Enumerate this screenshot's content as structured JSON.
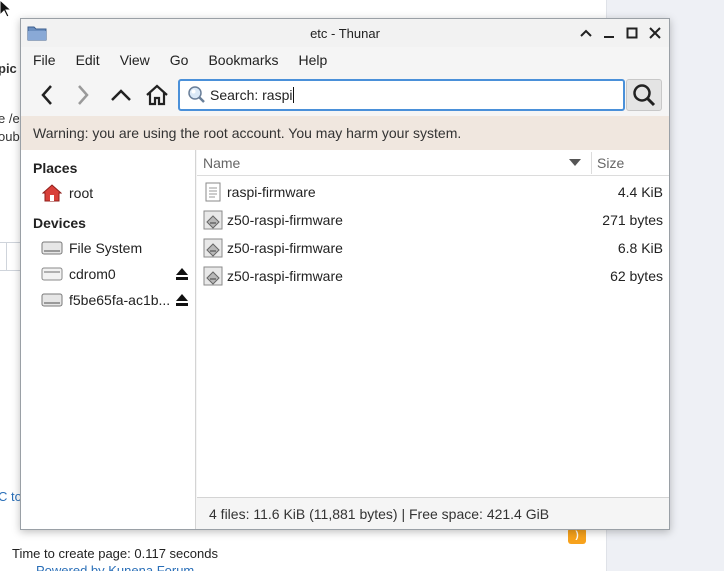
{
  "background": {
    "fragments": [
      "pic",
      "e /e",
      "oub",
      "C to"
    ],
    "footer": "Time to create page: 0.117 seconds",
    "powered": "Powered by Kunena Forum"
  },
  "window": {
    "title": "etc - Thunar"
  },
  "menu": [
    "File",
    "Edit",
    "View",
    "Go",
    "Bookmarks",
    "Help"
  ],
  "search": {
    "value": "Search: raspi"
  },
  "warning": "Warning: you are using the root account. You may harm your system.",
  "sidebar": {
    "places_heading": "Places",
    "places": [
      {
        "label": "root",
        "icon": "home-folder-icon"
      }
    ],
    "devices_heading": "Devices",
    "devices": [
      {
        "label": "File System",
        "icon": "drive-icon",
        "eject": false
      },
      {
        "label": "cdrom0",
        "icon": "optical-drive-icon",
        "eject": true
      },
      {
        "label": "f5be65fa-ac1b...",
        "icon": "drive-icon",
        "eject": true
      }
    ]
  },
  "columns": {
    "name": "Name",
    "size": "Size"
  },
  "files": [
    {
      "name": "raspi-firmware",
      "size": "4.4 KiB",
      "icon": "text-file-icon"
    },
    {
      "name": "z50-raspi-firmware",
      "size": "271 bytes",
      "icon": "script-file-icon"
    },
    {
      "name": "z50-raspi-firmware",
      "size": "6.8 KiB",
      "icon": "script-file-icon"
    },
    {
      "name": "z50-raspi-firmware",
      "size": "62 bytes",
      "icon": "script-file-icon"
    }
  ],
  "status": "4 files: 11.6 KiB (11,881 bytes)  |  Free space: 421.4 GiB",
  "colors": {
    "accent": "#4a90d9",
    "warning_bg": "#f0e7df",
    "home_icon": "#d9403a"
  }
}
